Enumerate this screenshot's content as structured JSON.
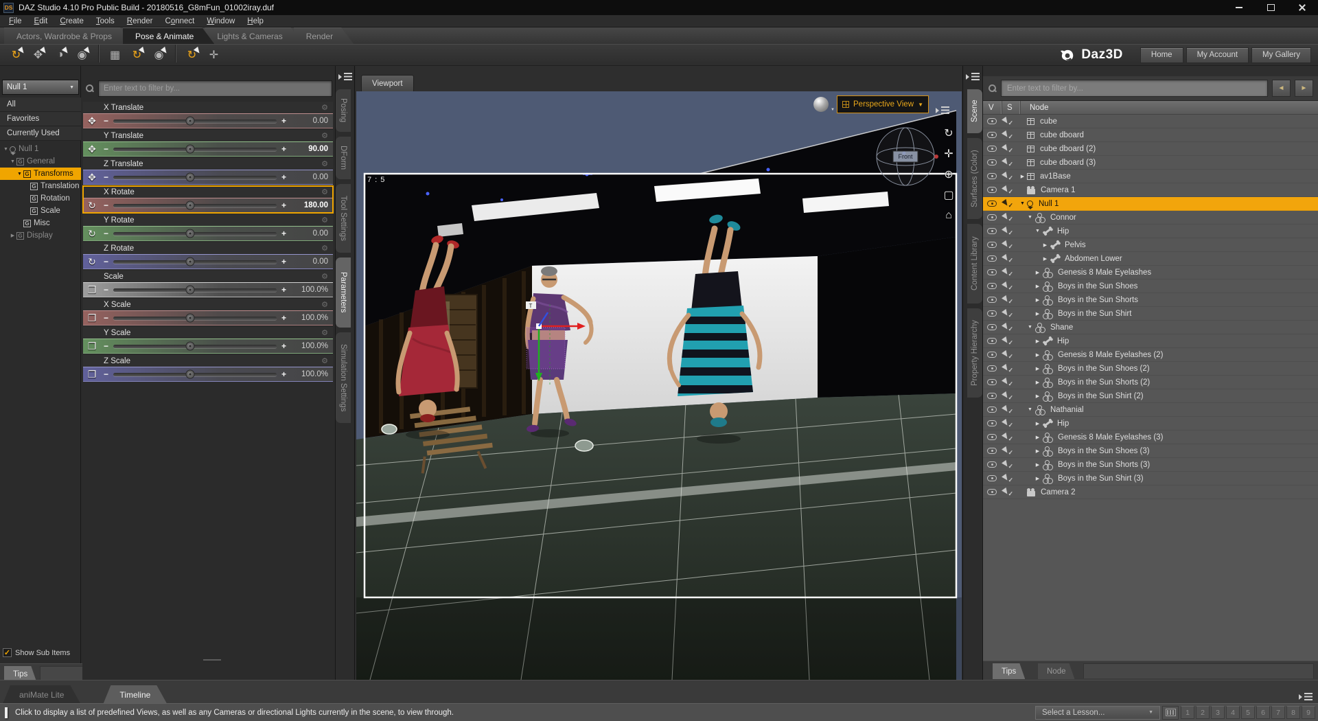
{
  "window": {
    "title": "DAZ Studio 4.10 Pro Public Build - 20180516_G8mFun_01002iray.duf",
    "app_icon": "DS"
  },
  "menu": {
    "items": [
      {
        "label": "File",
        "accel": 0
      },
      {
        "label": "Edit",
        "accel": 0
      },
      {
        "label": "Create",
        "accel": 0
      },
      {
        "label": "Tools",
        "accel": 0
      },
      {
        "label": "Render",
        "accel": 0
      },
      {
        "label": "Connect",
        "accel": 1
      },
      {
        "label": "Window",
        "accel": 0
      },
      {
        "label": "Help",
        "accel": 0
      }
    ]
  },
  "activity_tabs": [
    {
      "label": "Actors, Wardrobe & Props",
      "active": false
    },
    {
      "label": "Pose & Animate",
      "active": true
    },
    {
      "label": "Lights & Cameras",
      "active": false
    },
    {
      "label": "Render",
      "active": false
    }
  ],
  "brand": {
    "logo": "Daz3D",
    "buttons": [
      "Home",
      "My Account",
      "My Gallery"
    ]
  },
  "toolbar": {
    "groups": [
      [
        {
          "name": "node-selection-tool",
          "glyph": "↻",
          "accent": true,
          "cursor": true
        },
        {
          "name": "rotate-tool",
          "glyph": "✥",
          "accent": false,
          "cursor": true
        },
        {
          "name": "surface-selection-tool",
          "glyph": "◑",
          "accent": false,
          "cursor": true
        },
        {
          "name": "spot-render-tool",
          "glyph": "◉",
          "accent": false,
          "cursor": true
        }
      ],
      [
        {
          "name": "scene-navigator-tool",
          "glyph": "▦",
          "accent": false,
          "cursor": false
        },
        {
          "name": "active-pose-tool",
          "glyph": "↻",
          "accent": true,
          "cursor": true
        },
        {
          "name": "camera-tool",
          "glyph": "◉",
          "accent": false,
          "cursor": true
        }
      ],
      [
        {
          "name": "pose-tool",
          "glyph": "↻",
          "accent": true,
          "cursor": true
        },
        {
          "name": "measure-metrics-tool",
          "glyph": "✛",
          "accent": false,
          "cursor": false
        }
      ]
    ]
  },
  "left_panel": {
    "node_selector": "Null 1",
    "quick_rows": [
      "All",
      "Favorites",
      "Currently Used"
    ],
    "tree": [
      {
        "label": "Null 1",
        "level": 0,
        "arrow": "down",
        "icon": "null",
        "dim": true
      },
      {
        "label": "General",
        "level": 1,
        "arrow": "down",
        "icon": "g",
        "dim": true
      },
      {
        "label": "Transforms",
        "level": 2,
        "arrow": "down",
        "icon": "g",
        "selected": true
      },
      {
        "label": "Translation",
        "level": 3,
        "arrow": "none",
        "icon": "g"
      },
      {
        "label": "Rotation",
        "level": 3,
        "arrow": "none",
        "icon": "g"
      },
      {
        "label": "Scale",
        "level": 3,
        "arrow": "none",
        "icon": "g"
      },
      {
        "label": "Misc",
        "level": 2,
        "arrow": "none",
        "icon": "g"
      },
      {
        "label": "Display",
        "level": 1,
        "arrow": "right",
        "icon": "g",
        "dim": true
      }
    ],
    "show_sub_items": "Show Sub Items",
    "tips_tab": "Tips"
  },
  "parameters": {
    "filter_placeholder": "Enter text to filter by...",
    "sliders": [
      {
        "label": "X Translate",
        "value": "0.00",
        "tint": "red",
        "icon": "translate"
      },
      {
        "label": "Y Translate",
        "value": "90.00",
        "tint": "green",
        "icon": "translate",
        "bold": true
      },
      {
        "label": "Z Translate",
        "value": "0.00",
        "tint": "blue",
        "icon": "translate"
      },
      {
        "label": "X Rotate",
        "value": "180.00",
        "tint": "red",
        "icon": "rotate",
        "bold": true,
        "selected": true
      },
      {
        "label": "Y Rotate",
        "value": "0.00",
        "tint": "green",
        "icon": "rotate"
      },
      {
        "label": "Z Rotate",
        "value": "0.00",
        "tint": "blue",
        "icon": "rotate"
      },
      {
        "label": "Scale",
        "value": "100.0%",
        "tint": "grey",
        "icon": "scale"
      },
      {
        "label": "X Scale",
        "value": "100.0%",
        "tint": "red",
        "icon": "scale"
      },
      {
        "label": "Y Scale",
        "value": "100.0%",
        "tint": "green",
        "icon": "scale"
      },
      {
        "label": "Z Scale",
        "value": "100.0%",
        "tint": "blue",
        "icon": "scale"
      }
    ]
  },
  "left_tabs": [
    {
      "label": "Posing",
      "active": false
    },
    {
      "label": "DForm",
      "active": false
    },
    {
      "label": "Tool Settings",
      "active": false
    },
    {
      "label": "Parameters",
      "active": true
    },
    {
      "label": "Simulation Settings",
      "active": false
    }
  ],
  "viewport": {
    "tab": "Viewport",
    "aspect_label": "7 : 5",
    "view_selector": "Perspective View",
    "nav_cube_label": "Front",
    "side_icons": [
      {
        "name": "orbit-icon",
        "glyph": "↻"
      },
      {
        "name": "pan-icon",
        "glyph": "✛"
      },
      {
        "name": "zoom-icon",
        "glyph": "⊕"
      },
      {
        "name": "frame-icon",
        "glyph": "▢"
      },
      {
        "name": "home-view-icon",
        "glyph": "⌂"
      }
    ]
  },
  "right_tabs": [
    {
      "label": "Scene",
      "active": true
    },
    {
      "label": "Surfaces (Color)",
      "active": false
    },
    {
      "label": "Content Library",
      "active": false
    },
    {
      "label": "Property Hierarchy",
      "active": false
    }
  ],
  "scene": {
    "filter_placeholder": "Enter text to filter by...",
    "columns": [
      "V",
      "S",
      "Node"
    ],
    "rows": [
      {
        "label": "cube",
        "level": 0,
        "arrow": "none",
        "icon": "cube"
      },
      {
        "label": "cube dboard",
        "level": 0,
        "arrow": "none",
        "icon": "cube"
      },
      {
        "label": "cube dboard (2)",
        "level": 0,
        "arrow": "none",
        "icon": "cube"
      },
      {
        "label": "cube dboard (3)",
        "level": 0,
        "arrow": "none",
        "icon": "cube"
      },
      {
        "label": "av1Base",
        "level": 0,
        "arrow": "right",
        "icon": "cube"
      },
      {
        "label": "Camera 1",
        "level": 0,
        "arrow": "none",
        "icon": "camera"
      },
      {
        "label": "Null 1",
        "level": 0,
        "arrow": "down",
        "icon": "null",
        "selected": true
      },
      {
        "label": "Connor",
        "level": 1,
        "arrow": "down",
        "icon": "figure"
      },
      {
        "label": "Hip",
        "level": 2,
        "arrow": "down",
        "icon": "bone"
      },
      {
        "label": "Pelvis",
        "level": 3,
        "arrow": "right",
        "icon": "bone"
      },
      {
        "label": "Abdomen Lower",
        "level": 3,
        "arrow": "right",
        "icon": "bone"
      },
      {
        "label": "Genesis 8 Male Eyelashes",
        "level": 2,
        "arrow": "right",
        "icon": "figure"
      },
      {
        "label": "Boys in the Sun Shoes",
        "level": 2,
        "arrow": "right",
        "icon": "figure"
      },
      {
        "label": "Boys in the Sun Shorts",
        "level": 2,
        "arrow": "right",
        "icon": "figure"
      },
      {
        "label": "Boys in the Sun Shirt",
        "level": 2,
        "arrow": "right",
        "icon": "figure"
      },
      {
        "label": "Shane",
        "level": 1,
        "arrow": "down",
        "icon": "figure"
      },
      {
        "label": "Hip",
        "level": 2,
        "arrow": "right",
        "icon": "bone"
      },
      {
        "label": "Genesis 8 Male Eyelashes (2)",
        "level": 2,
        "arrow": "right",
        "icon": "figure"
      },
      {
        "label": "Boys in the Sun Shoes (2)",
        "level": 2,
        "arrow": "right",
        "icon": "figure"
      },
      {
        "label": "Boys in the Sun Shorts (2)",
        "level": 2,
        "arrow": "right",
        "icon": "figure"
      },
      {
        "label": "Boys in the Sun Shirt (2)",
        "level": 2,
        "arrow": "right",
        "icon": "figure"
      },
      {
        "label": "Nathanial",
        "level": 1,
        "arrow": "down",
        "icon": "figure"
      },
      {
        "label": "Hip",
        "level": 2,
        "arrow": "right",
        "icon": "bone"
      },
      {
        "label": "Genesis 8 Male Eyelashes (3)",
        "level": 2,
        "arrow": "right",
        "icon": "figure"
      },
      {
        "label": "Boys in the Sun Shoes (3)",
        "level": 2,
        "arrow": "right",
        "icon": "figure"
      },
      {
        "label": "Boys in the Sun Shorts (3)",
        "level": 2,
        "arrow": "right",
        "icon": "figure"
      },
      {
        "label": "Boys in the Sun Shirt (3)",
        "level": 2,
        "arrow": "right",
        "icon": "figure"
      },
      {
        "label": "Camera 2",
        "level": 0,
        "arrow": "none",
        "icon": "camera"
      }
    ],
    "bottom_tabs": [
      {
        "label": "Tips",
        "active": true
      },
      {
        "label": "Node",
        "active": false
      }
    ]
  },
  "timeline": {
    "tabs": [
      {
        "label": "aniMate Lite",
        "active": false
      },
      {
        "label": "Timeline",
        "active": true
      }
    ]
  },
  "status": {
    "message": "Click to display a list of predefined Views, as well as any Cameras or directional Lights currently in the scene, to view through.",
    "lesson_select": "Select a Lesson...",
    "lesson_buttons": [
      "1",
      "2",
      "3",
      "4",
      "5",
      "6",
      "7",
      "8",
      "9"
    ]
  },
  "colors": {
    "accent": "#F0A500",
    "selection_yellow": "#F2A50C",
    "viewport_background": "#4E5A74",
    "tint_red": "#96625F",
    "tint_green": "#64905E",
    "tint_blue": "#61619C"
  }
}
